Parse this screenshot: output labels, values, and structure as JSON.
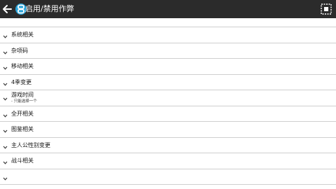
{
  "appbar": {
    "title": "启用/禁用作弊",
    "icons": [
      "back-arrow-icon",
      "app-icon",
      "select-all-icon"
    ]
  },
  "warning": {
    "text": ""
  },
  "categories": [
    {
      "label": "系统相关",
      "sub": ""
    },
    {
      "label": "杂项码",
      "sub": ""
    },
    {
      "label": "移动相关",
      "sub": ""
    },
    {
      "label": "4季变更",
      "sub": ""
    },
    {
      "label": "游戏时间",
      "sub": "- 只能选择一个"
    },
    {
      "label": "全开相关",
      "sub": ""
    },
    {
      "label": "图鉴相关",
      "sub": ""
    },
    {
      "label": "主人公性别变更",
      "sub": ""
    },
    {
      "label": "战斗相关",
      "sub": ""
    },
    {
      "label": "",
      "sub": ""
    }
  ]
}
